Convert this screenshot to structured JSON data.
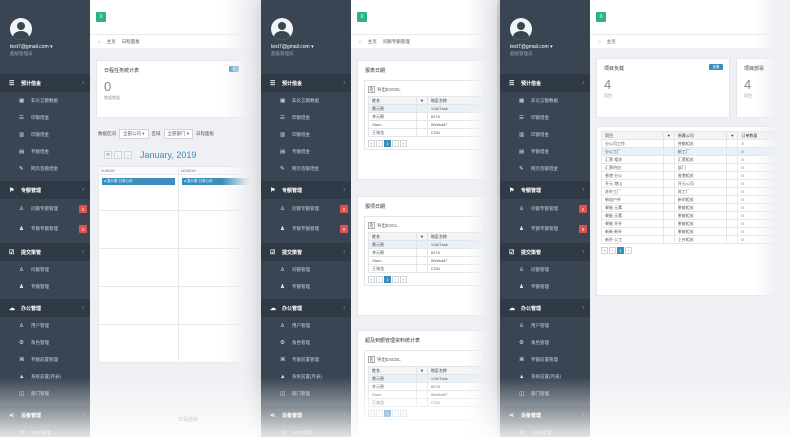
{
  "user": {
    "email": "test7@gmail.com",
    "role": "超级管理员"
  },
  "sidebar": {
    "sections": [
      {
        "label": "预计借金",
        "icon": "list-icon",
        "items": [
          {
            "label": "非论言额数据",
            "icon": "grid-icon"
          },
          {
            "label": "印额借金",
            "icon": "list-icon"
          },
          {
            "label": "印额借金",
            "icon": "bar-icon"
          },
          {
            "label": "专额借金",
            "icon": "doc-icon"
          },
          {
            "label": "网页签额借金",
            "icon": "pin-icon"
          }
        ]
      },
      {
        "label": "专额管理",
        "icon": "flag-icon",
        "items": [
          {
            "label": "问额专额管理",
            "icon": "user-icon",
            "badge": "0"
          },
          {
            "label": "专额专额管理",
            "icon": "users-icon",
            "badge": "0"
          }
        ]
      },
      {
        "label": "提交策管",
        "icon": "check-icon",
        "items": [
          {
            "label": "问额管理",
            "icon": "user-icon"
          },
          {
            "label": "专额管理",
            "icon": "users-icon"
          }
        ]
      },
      {
        "label": "办公管理",
        "icon": "cloud-icon",
        "items": [
          {
            "label": "用户管理",
            "icon": "user-icon"
          },
          {
            "label": "角色管理",
            "icon": "gear-icon"
          },
          {
            "label": "专额前置管理",
            "icon": "tag-icon"
          },
          {
            "label": "系统前置(月表)",
            "icon": "chart-icon"
          },
          {
            "label": "部门管理",
            "icon": "box-icon"
          }
        ]
      },
      {
        "label": "设备管理",
        "icon": "share-icon",
        "items": [
          {
            "label": "VOIP管理",
            "icon": "phone-icon"
          },
          {
            "label": "卡号管理",
            "icon": "card-icon"
          }
        ]
      }
    ]
  },
  "panel1": {
    "breadcrumb": [
      "主页",
      "日程面板"
    ],
    "card1": {
      "title": "日程任务统计表",
      "value": "0",
      "label": "数据数据",
      "button": "查"
    },
    "card2": {
      "value": "0"
    },
    "filters": {
      "label1": "数据区间",
      "value1": "全部公司",
      "label2": "区域",
      "value2": "全部部门",
      "label3": "日程面板"
    },
    "calendar": {
      "month": "January, 2019",
      "weekdays": [
        "SUNDAY",
        "MONDAY",
        ""
      ],
      "weeks": [
        [
          "",
          "",
          ""
        ],
        [
          "",
          "28",
          ""
        ],
        [
          "",
          "21",
          ""
        ],
        [
          "",
          "27",
          ""
        ],
        [
          "",
          "23",
          ""
        ]
      ],
      "event_text": "● 暂计数 日常公司"
    },
    "footer": "日程面板"
  },
  "panel2": {
    "breadcrumb": [
      "主页",
      "问额专额管理"
    ],
    "cards": [
      {
        "title": "报表日期",
        "tool": "导出EXCEL",
        "headers": [
          "姓名",
          "",
          "地区名称"
        ],
        "rows": [
          [
            "需元朝",
            "",
            "11/6/Task"
          ],
          [
            "李元朝",
            "",
            "6078"
          ],
          [
            "Glam",
            "",
            "Weeball7"
          ],
          [
            "王海龙",
            "",
            "CGN"
          ]
        ]
      },
      {
        "title": "报项日期",
        "tool": "导出EXCL",
        "headers": [
          "姓名",
          "",
          "地区名称"
        ],
        "rows": [
          [
            "需元朝",
            "",
            "11/6/Task"
          ],
          [
            "李元朝",
            "",
            "6078"
          ],
          [
            "Glam",
            "",
            "Weeball7"
          ],
          [
            "王海龙",
            "",
            "CGN"
          ]
        ]
      },
      {
        "title": "超及到额管理资料统计表",
        "tool": "导出EXCEL",
        "headers": [
          "姓名",
          "",
          "地区名称"
        ],
        "rows": [
          [
            "需元朝",
            "",
            "11/6/Task"
          ],
          [
            "李元朝",
            "",
            "6078"
          ],
          [
            "Glam",
            "",
            "Weeball7"
          ],
          [
            "王海龙",
            "",
            "CGN"
          ]
        ]
      }
    ],
    "pages": [
      "«",
      "‹",
      "1",
      "›",
      "»"
    ]
  },
  "panel3": {
    "breadcrumb": [
      "主页"
    ],
    "card1": {
      "title": "项目负载",
      "value": "4",
      "label": "项目",
      "button": "查看"
    },
    "card2": {
      "title": "项目部署",
      "value": "4",
      "label": "项目"
    },
    "table": {
      "headers": [
        "项目",
        "",
        "所属公司",
        "",
        "订单数量"
      ],
      "rows": [
        [
          "分公司工作",
          "",
          "苍额相关",
          "",
          "3"
        ],
        [
          "分公工厂",
          "",
          "新工厂",
          "",
          "0"
        ],
        [
          "汇票 相关",
          "",
          "汇票相关",
          "",
          "0"
        ],
        [
          "汇票供应",
          "",
          "部门",
          "",
          "0"
        ],
        [
          "香港 分公",
          "",
          "香港相关",
          "",
          "0"
        ],
        [
          "开元 港山",
          "",
          "开元公司",
          "",
          "0"
        ],
        [
          "苏外工厂",
          "",
          "苏工厂",
          "",
          "0"
        ],
        [
          "新加户外",
          "",
          "新的相关",
          "",
          "0"
        ],
        [
          "果能 元素",
          "",
          "果能相关",
          "",
          "0"
        ],
        [
          "果能 元素",
          "",
          "果能相关",
          "",
          "0"
        ],
        [
          "果能 开外",
          "",
          "果能相关",
          "",
          "0"
        ],
        [
          "新新 新外",
          "",
          "果能相关",
          "",
          "0"
        ],
        [
          "新外 公工",
          "",
          "上外相关",
          "",
          "0"
        ]
      ]
    },
    "pages": [
      "«",
      "‹",
      "1",
      "›"
    ]
  }
}
